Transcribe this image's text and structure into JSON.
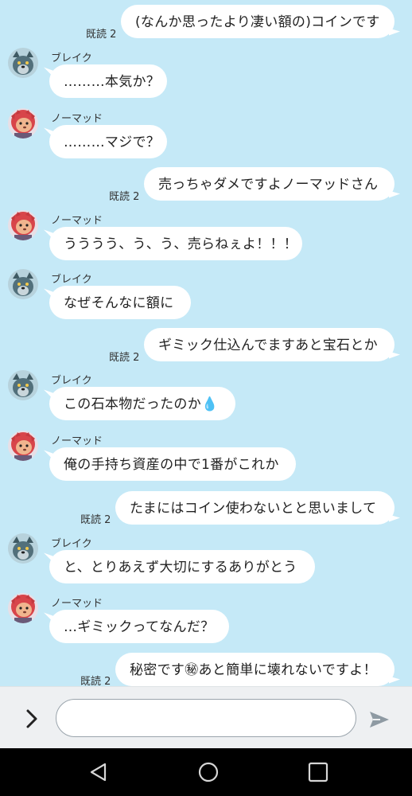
{
  "messages": [
    {
      "side": "out",
      "text": "(なんか思ったより凄い額の)コインです",
      "read": "既読 2"
    },
    {
      "side": "in",
      "sender": "ブレイク",
      "avatar": "wolf",
      "text": "………本気か？"
    },
    {
      "side": "in",
      "sender": "ノーマッド",
      "avatar": "lion",
      "text": "………マジで？"
    },
    {
      "side": "out",
      "text": "売っちゃダメですよノーマッドさん",
      "read": "既読 2"
    },
    {
      "side": "in",
      "sender": "ノーマッド",
      "avatar": "lion",
      "text": "うううう、う、う、売らねぇよ！！！"
    },
    {
      "side": "in",
      "sender": "ブレイク",
      "avatar": "wolf",
      "text": "なぜそんなに額に"
    },
    {
      "side": "out",
      "text": "ギミック仕込んでますあと宝石とか",
      "read": "既読 2"
    },
    {
      "side": "in",
      "sender": "ブレイク",
      "avatar": "wolf",
      "text": "この石本物だったのか💧"
    },
    {
      "side": "in",
      "sender": "ノーマッド",
      "avatar": "lion",
      "text": "俺の手持ち資産の中で1番がこれか"
    },
    {
      "side": "out",
      "text": "たまにはコイン使わないとと思いまして",
      "read": "既読 2"
    },
    {
      "side": "in",
      "sender": "ブレイク",
      "avatar": "wolf",
      "text": "と、とりあえず大切にするありがとう"
    },
    {
      "side": "in",
      "sender": "ノーマッド",
      "avatar": "lion",
      "text": "…ギミックってなんだ？"
    },
    {
      "side": "out",
      "text": "秘密です㊙あと簡単に壊れないですよ！",
      "read": "既読 2"
    }
  ],
  "input": {
    "placeholder": "",
    "value": ""
  },
  "icons": {
    "expand": "chevron-right-icon",
    "send": "send-icon",
    "back": "android-back-icon",
    "home": "android-home-icon",
    "recents": "android-recents-icon"
  },
  "colors": {
    "background": "#c5e9f7",
    "bubble": "#ffffff",
    "nav": "#000000"
  }
}
